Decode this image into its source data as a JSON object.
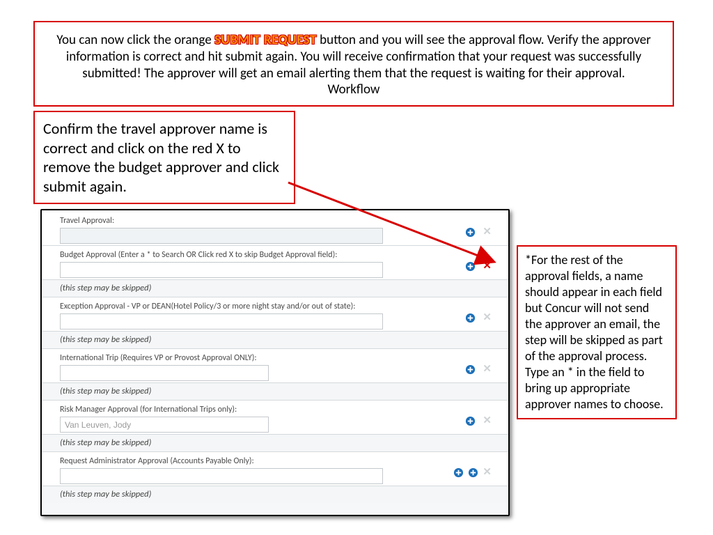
{
  "top": {
    "t1": "You can now click the orange ",
    "emph": "SUBMIT REQUEST",
    "t2": " button and you will see the approval flow.  Verify the approver information is correct and hit submit again.  You will receive confirmation that your request was successfully submitted! The approver will get an email alerting them that the request is waiting for their approval.",
    "t3": "Workflow"
  },
  "confirm": "Confirm the travel approver name is correct and click on the red X to remove the budget approver and click submit again.",
  "side": "*For the rest of the approval fields, a name should appear in each field but Concur will not send the approver an email, the step will be skipped as part of the approval process.  Type an * in the field to bring up appropriate approver names to choose.",
  "skip": "(this step may be skipped)",
  "sections": {
    "s1_label": "Travel Approval:",
    "s2_label": "Budget Approval (Enter a * to Search OR Click red X to skip Budget Approval field):",
    "s3_label": "Exception Approval - VP or DEAN(Hotel Policy/3 or more night stay and/or out of state):",
    "s4_label": "International Trip (Requires VP or Provost Approval ONLY):",
    "s5_label": "Risk Manager Approval (for International Trips only):",
    "s5_value": "Van Leuven, Jody",
    "s6_label": "Request Administrator Approval (Accounts Payable Only):"
  }
}
